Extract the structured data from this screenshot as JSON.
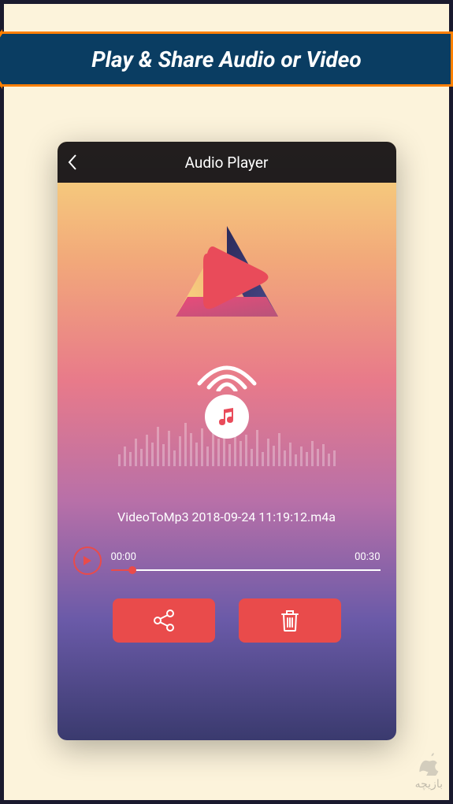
{
  "banner": {
    "title": "Play & Share Audio or Video"
  },
  "app": {
    "title": "Audio Player",
    "filename": "VideoToMp3 2018-09-24 11:19:12.m4a",
    "time_current": "00:00",
    "time_total": "00:30",
    "accent": "#e94b4b"
  },
  "icons": {
    "back": "chevron-left-icon",
    "play": "play-icon",
    "share": "share-icon",
    "delete": "trash-icon",
    "music": "music-note-icon",
    "broadcast": "wifi-icon",
    "logo": "triangle-play-logo"
  },
  "watermark": {
    "text": "بازیچه"
  }
}
